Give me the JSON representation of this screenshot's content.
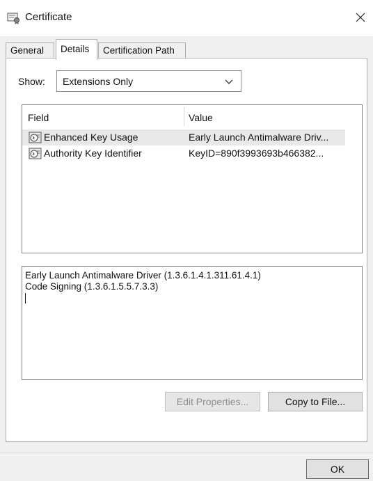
{
  "window": {
    "title": "Certificate",
    "icon": "certificate-icon",
    "close_icon": "close-icon"
  },
  "tabs": [
    {
      "label": "General",
      "active": false
    },
    {
      "label": "Details",
      "active": true
    },
    {
      "label": "Certification Path",
      "active": false
    }
  ],
  "details": {
    "show_label": "Show:",
    "show_value": "Extensions Only",
    "columns": {
      "field": "Field",
      "value": "Value"
    },
    "rows": [
      {
        "field": "Enhanced Key Usage",
        "value": "Early Launch Antimalware Driv...",
        "selected": true,
        "icon": "extension-icon"
      },
      {
        "field": "Authority Key Identifier",
        "value": "KeyID=890f3993693b466382...",
        "selected": false,
        "icon": "extension-icon"
      }
    ],
    "detail_lines": [
      "Early Launch Antimalware Driver (1.3.6.1.4.1.311.61.4.1)",
      "Code Signing (1.3.6.1.5.5.7.3.3)"
    ],
    "edit_properties_label": "Edit Properties...",
    "copy_to_file_label": "Copy to File..."
  },
  "footer": {
    "ok_label": "OK"
  }
}
